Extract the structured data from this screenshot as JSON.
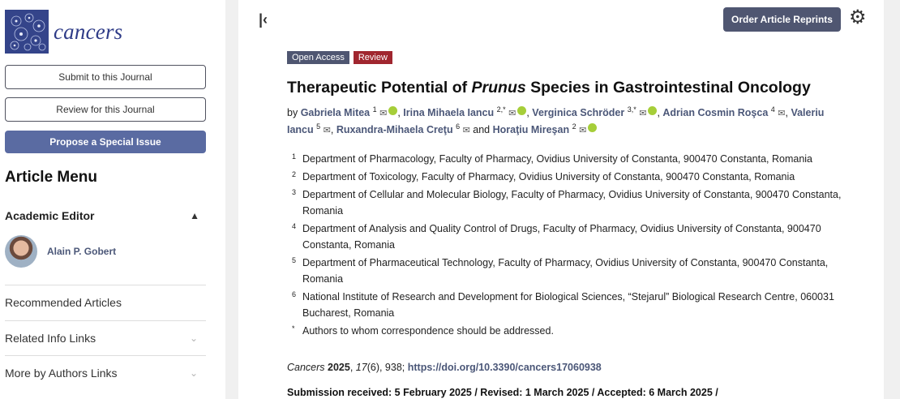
{
  "journal": {
    "name": "cancers"
  },
  "sidebar": {
    "buttons": [
      {
        "label": "Submit to this Journal"
      },
      {
        "label": "Review for this Journal"
      },
      {
        "label": "Propose a Special Issue"
      }
    ],
    "menu_title": "Article Menu",
    "academic_editor": {
      "title": "Academic Editor",
      "name": "Alain P. Gobert"
    },
    "links": [
      {
        "label": "Recommended Articles"
      },
      {
        "label": "Related Info Links"
      },
      {
        "label": "More by Authors Links"
      }
    ]
  },
  "toolbar": {
    "reprints_label": "Order Article Reprints"
  },
  "article": {
    "badges": [
      "Open Access",
      "Review"
    ],
    "title_pre": "Therapeutic Potential of ",
    "title_em": "Prunus",
    "title_post": " Species in Gastrointestinal Oncology",
    "by": "by",
    "and": "and",
    "authors": [
      {
        "name": "Gabriela Mitea",
        "aff": "1",
        "orcid": true
      },
      {
        "name": "Irina Mihaela Iancu",
        "aff": "2,*",
        "orcid": true
      },
      {
        "name": "Verginica Schröder",
        "aff": "3,*",
        "orcid": true
      },
      {
        "name": "Adrian Cosmin Roşca",
        "aff": "4",
        "orcid": false
      },
      {
        "name": "Valeriu Iancu",
        "aff": "5",
        "orcid": false
      },
      {
        "name": "Ruxandra-Mihaela Creţu",
        "aff": "6",
        "orcid": false
      },
      {
        "name": "Horaţiu Mireşan",
        "aff": "2",
        "orcid": true
      }
    ],
    "affiliations": [
      {
        "num": "1",
        "text": "Department of Pharmacology, Faculty of Pharmacy, Ovidius University of Constanta, 900470 Constanta, Romania"
      },
      {
        "num": "2",
        "text": "Department of Toxicology, Faculty of Pharmacy, Ovidius University of Constanta, 900470 Constanta, Romania"
      },
      {
        "num": "3",
        "text": "Department of Cellular and Molecular Biology, Faculty of Pharmacy, Ovidius University of Constanta, 900470 Constanta, Romania"
      },
      {
        "num": "4",
        "text": "Department of Analysis and Quality Control of Drugs, Faculty of Pharmacy, Ovidius University of Constanta, 900470 Constanta, Romania"
      },
      {
        "num": "5",
        "text": "Department of Pharmaceutical Technology, Faculty of Pharmacy, Ovidius University of Constanta, 900470 Constanta, Romania"
      },
      {
        "num": "6",
        "text": "National Institute of Research and Development for Biological Sciences, “Stejarul” Biological Research Centre, 060031 Bucharest, Romania"
      },
      {
        "num": "*",
        "text": "Authors to whom correspondence should be addressed."
      }
    ],
    "citation": {
      "journal": "Cancers",
      "year": "2025",
      "volume": "17",
      "issue_rest": "(6), 938; ",
      "doi": "https://doi.org/10.3390/cancers17060938"
    },
    "dates": "Submission received: 5 February 2025 / Revised: 1 March 2025 / Accepted: 6 March 2025 /"
  }
}
